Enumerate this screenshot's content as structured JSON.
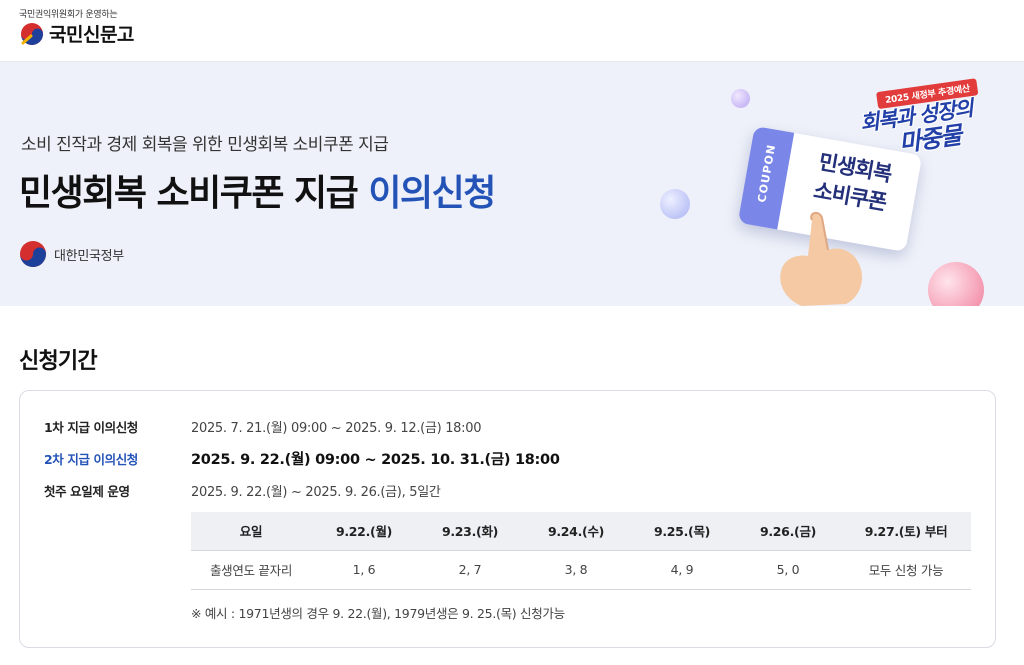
{
  "header": {
    "logo_subtitle": "국민권익위원회가 운영하는",
    "logo_name": "국민신문고"
  },
  "banner": {
    "subtitle": "소비 진작과 경제 회복을 위한 민생회복 소비쿠폰 지급",
    "title_main": "민생회복 소비쿠폰 지급",
    "title_accent": "이의신청",
    "gov_name": "대한민국정부",
    "coupon_word": "COUPON",
    "coupon_line1": "민생회복",
    "coupon_line2": "소비쿠폰",
    "badge_pill": "2025 새정부 추경예산",
    "badge_line1": "회복과 성장의",
    "badge_line2": "마중물"
  },
  "section": {
    "title": "신청기간"
  },
  "periods": [
    {
      "label": "1차 지급 이의신청",
      "value": "2025. 7. 21.(월) 09:00 ~ 2025. 9. 12.(금) 18:00"
    },
    {
      "label": "2차 지급 이의신청",
      "value": "2025. 9. 22.(월) 09:00 ~ 2025. 10. 31.(금) 18:00"
    },
    {
      "label": "첫주 요일제 운영",
      "value": "2025. 9. 22.(월) ~ 2025. 9. 26.(금), 5일간"
    }
  ],
  "schedule": {
    "headers": [
      "요일",
      "9.22.(월)",
      "9.23.(화)",
      "9.24.(수)",
      "9.25.(목)",
      "9.26.(금)",
      "9.27.(토) 부터"
    ],
    "row": [
      "출생연도 끝자리",
      "1, 6",
      "2, 7",
      "3, 8",
      "4, 9",
      "5, 0",
      "모두 신청 가능"
    ]
  },
  "note": "※ 예시 : 1971년생의 경우 9. 22.(월), 1979년생은 9. 25.(목) 신청가능",
  "colors": {
    "accent": "#2453b8",
    "banner_bg": "#eef1f9",
    "table_header_bg": "#eef0f4"
  },
  "icons": {
    "logo": "taegeuk-brush-icon",
    "government": "taegeuk-icon"
  }
}
